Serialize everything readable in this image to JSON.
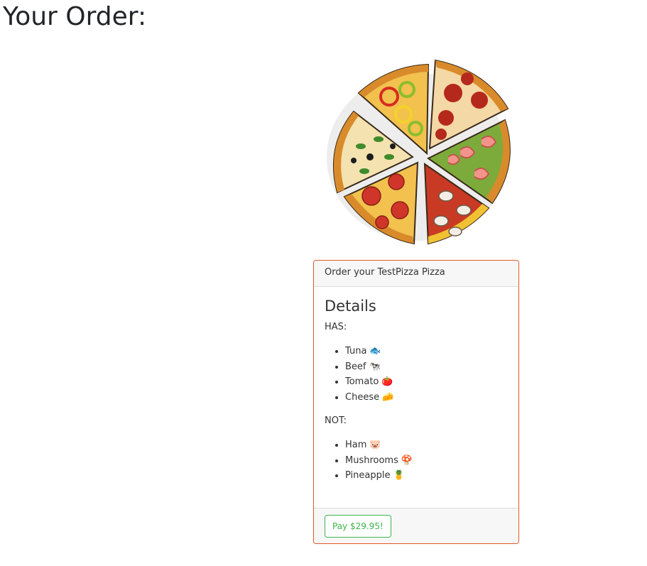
{
  "page": {
    "title": "Your Order:"
  },
  "image": {
    "icon": "pizza-slices-image"
  },
  "card": {
    "header": "Order your TestPizza Pizza",
    "title": "Details",
    "has_label": "HAS:",
    "has_items": [
      {
        "label": "Tuna",
        "emoji": "🐟"
      },
      {
        "label": "Beef",
        "emoji": "🐄"
      },
      {
        "label": "Tomato",
        "emoji": "🍅"
      },
      {
        "label": "Cheese",
        "emoji": "🧀"
      }
    ],
    "not_label": "NOT:",
    "not_items": [
      {
        "label": "Ham",
        "emoji": "🐷"
      },
      {
        "label": "Mushrooms",
        "emoji": "🍄"
      },
      {
        "label": "Pineapple",
        "emoji": "🍍"
      }
    ],
    "pay_label": "Pay $29.95!"
  },
  "colors": {
    "card_border": "#e05a2a",
    "pay_button": "#3cb54a"
  }
}
